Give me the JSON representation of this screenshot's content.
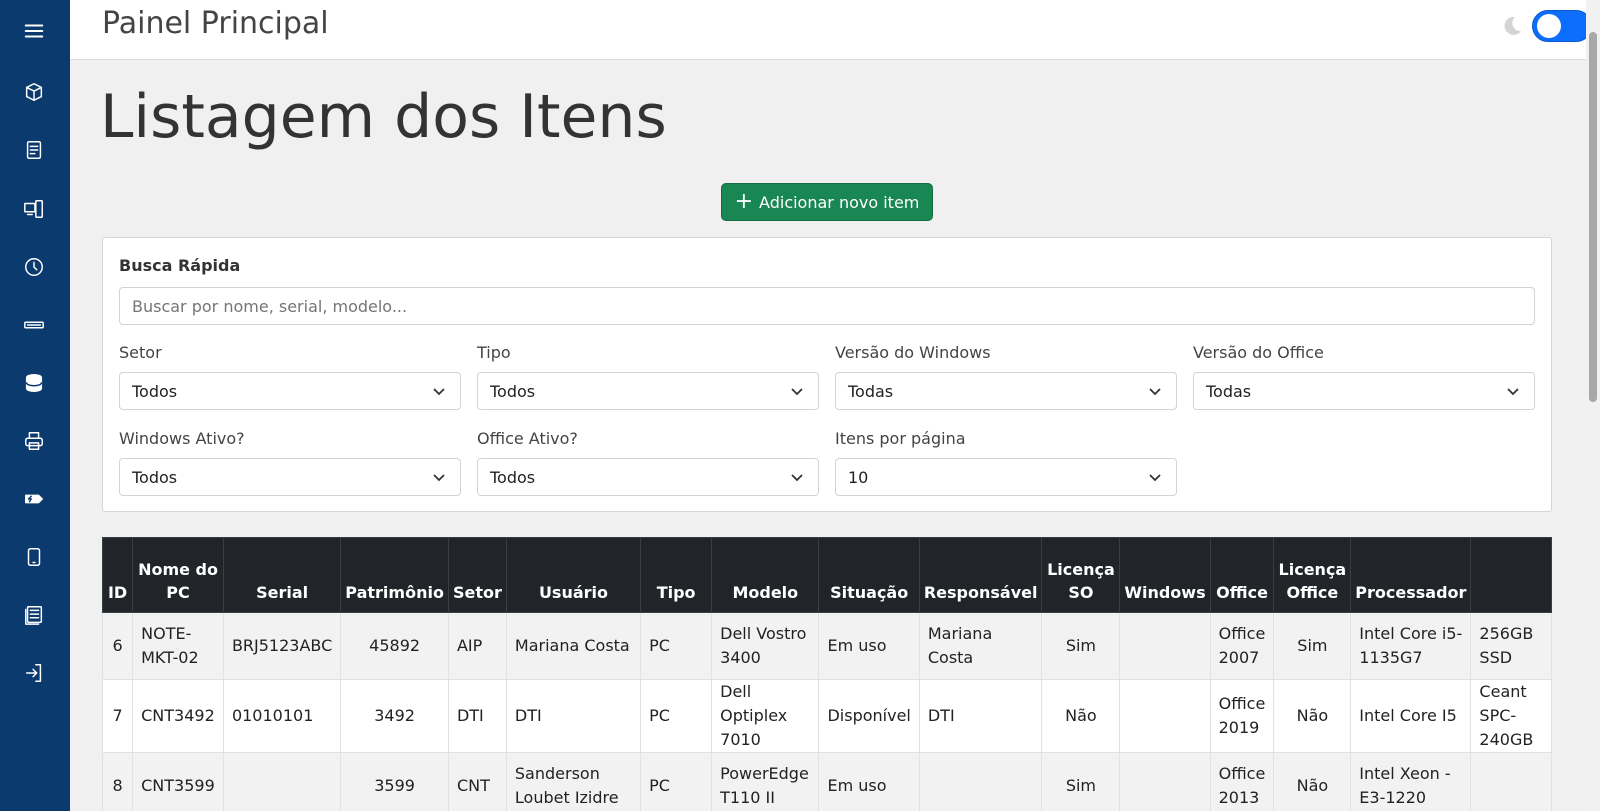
{
  "app": {
    "title": "Painel Principal"
  },
  "theme": {
    "accent": "#0b3a6e",
    "toggle_color": "#0d6efd",
    "button_color": "#198754",
    "sun_color": "#f2b01e"
  },
  "sidebar": {
    "items": [
      {
        "icon": "menu-icon"
      },
      {
        "icon": "box-icon"
      },
      {
        "icon": "document-icon"
      },
      {
        "icon": "devices-icon"
      },
      {
        "icon": "history-icon"
      },
      {
        "icon": "keyboard-icon"
      },
      {
        "icon": "database-icon"
      },
      {
        "icon": "printer-icon"
      },
      {
        "icon": "toner-icon"
      },
      {
        "icon": "tablet-icon"
      },
      {
        "icon": "report-icon"
      },
      {
        "icon": "logout-icon"
      }
    ]
  },
  "main": {
    "title": "Listagem dos Itens",
    "add_button": "Adicionar novo item"
  },
  "filters": {
    "quick_search_label": "Busca Rápida",
    "search_placeholder": "Buscar por nome, serial, modelo...",
    "setor": {
      "label": "Setor",
      "value": "Todos"
    },
    "tipo": {
      "label": "Tipo",
      "value": "Todos"
    },
    "windows_version": {
      "label": "Versão do Windows",
      "value": "Todas"
    },
    "office_version": {
      "label": "Versão do Office",
      "value": "Todas"
    },
    "windows_active": {
      "label": "Windows Ativo?",
      "value": "Todos"
    },
    "office_active": {
      "label": "Office Ativo?",
      "value": "Todos"
    },
    "per_page": {
      "label": "Itens por página",
      "value": "10"
    }
  },
  "table": {
    "headers": [
      "ID",
      "Nome do PC",
      "Serial",
      "Patrimônio",
      "Setor",
      "Usuário",
      "Tipo",
      "Modelo",
      "Situação",
      "Responsável",
      "Licença SO",
      "Windows",
      "Office",
      "Licença Office",
      "Processador",
      ""
    ],
    "rows": [
      [
        "6",
        "NOTE-MKT-02",
        "BRJ5123ABC",
        "45892",
        "AIP",
        "Mariana Costa",
        "PC",
        "Dell Vostro 3400",
        "Em uso",
        "Mariana Costa",
        "Sim",
        "",
        "Office 2007",
        "Sim",
        "Intel Core i5-1135G7",
        "256GB SSD"
      ],
      [
        "7",
        "CNT3492",
        "01010101",
        "3492",
        "DTI",
        "DTI",
        "PC",
        "Dell Optiplex 7010",
        "Disponível",
        "DTI",
        "Não",
        "",
        "Office 2019",
        "Não",
        "Intel Core I5",
        "Ceant SPC-240GB"
      ],
      [
        "8",
        "CNT3599",
        "",
        "3599",
        "CNT",
        "Sanderson Loubet Izidre",
        "PC",
        "PowerEdge T110 II",
        "Em uso",
        "",
        "Sim",
        "",
        "Office 2013",
        "Não",
        "Intel Xeon - E3-1220",
        ""
      ]
    ]
  }
}
